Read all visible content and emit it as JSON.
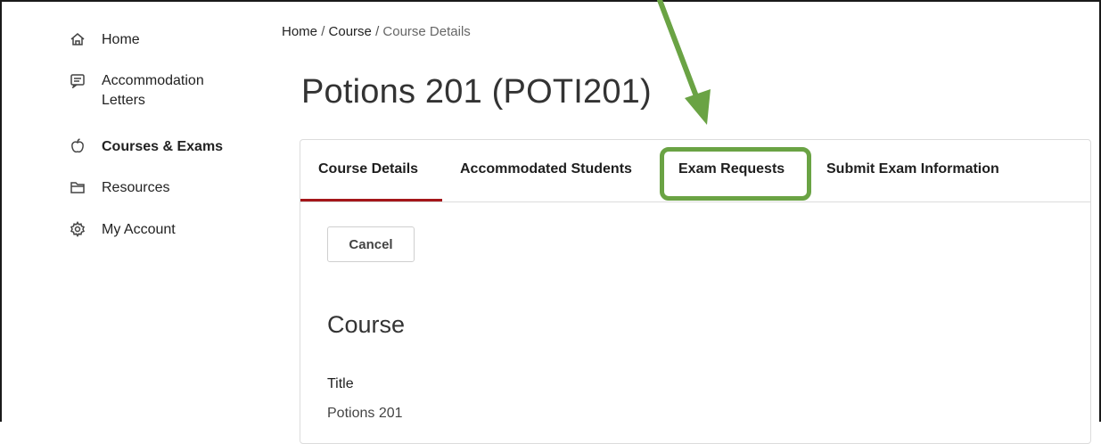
{
  "sidebar": {
    "items": [
      {
        "label": "Home",
        "icon": "home-icon"
      },
      {
        "label": "Accommodation\nLetters",
        "label_line1": "Accommodation",
        "label_line2": "Letters",
        "icon": "letter-icon"
      },
      {
        "label": "Courses & Exams",
        "icon": "apple-icon",
        "active": true
      },
      {
        "label": "Resources",
        "icon": "folder-icon"
      },
      {
        "label": "My Account",
        "icon": "gear-icon"
      }
    ]
  },
  "breadcrumb": {
    "items": [
      "Home",
      "Course",
      "Course Details"
    ],
    "separator": "/"
  },
  "page": {
    "title": "Potions 201 (POTI201)"
  },
  "tabs": [
    {
      "label": "Course Details",
      "active": true
    },
    {
      "label": "Accommodated Students"
    },
    {
      "label": "Exam Requests",
      "highlighted": true
    },
    {
      "label": "Submit Exam Information"
    }
  ],
  "form": {
    "cancel_label": "Cancel",
    "section_title": "Course",
    "fields": [
      {
        "label": "Title",
        "value": "Potions 201"
      }
    ]
  },
  "colors": {
    "active_tab_underline": "#a4161a",
    "highlight": "#6aa344",
    "arrow": "#6aa344"
  }
}
